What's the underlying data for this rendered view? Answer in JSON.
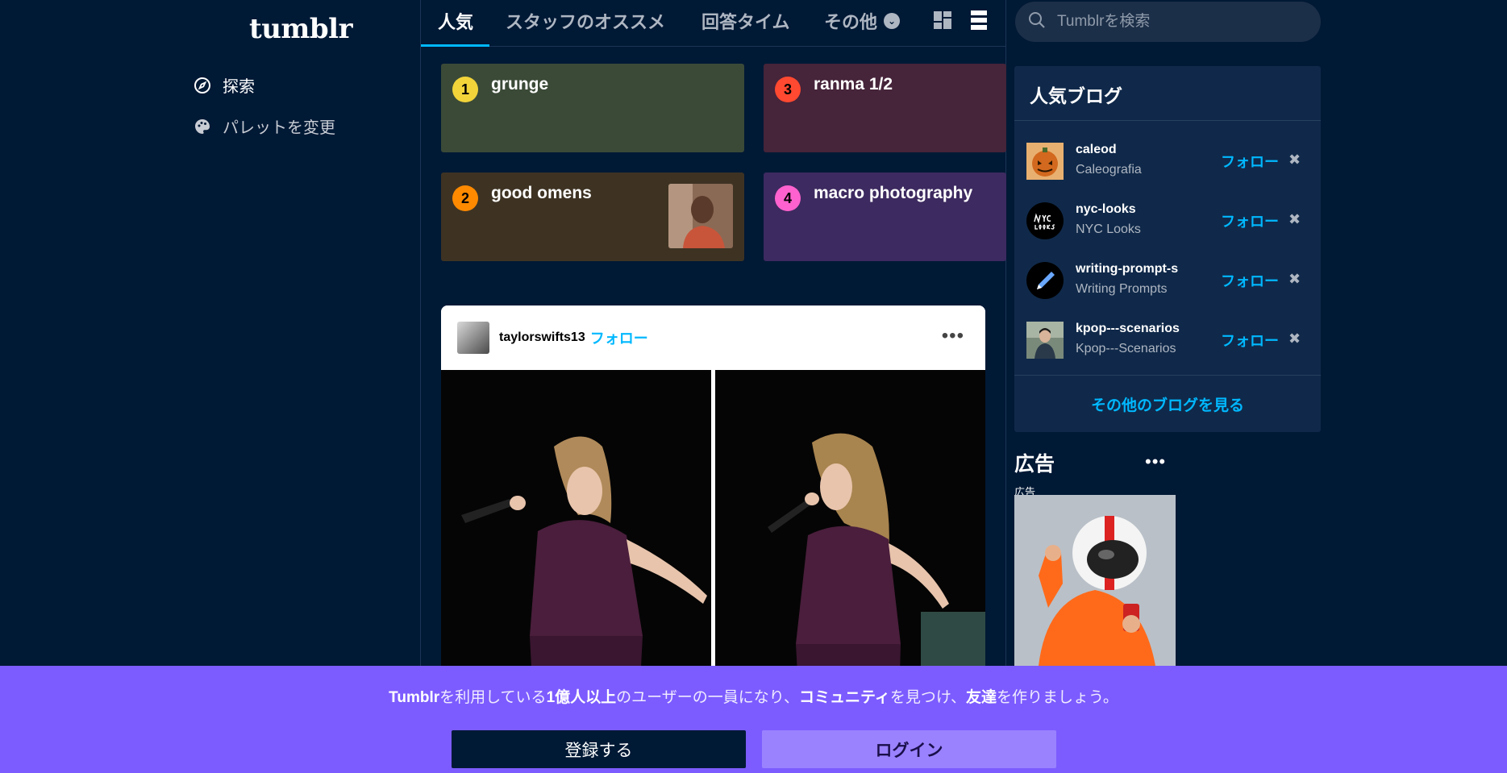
{
  "app": {
    "logo": "tumblr"
  },
  "nav": {
    "explore": {
      "label": "探索",
      "icon": "compass-icon"
    },
    "palette": {
      "label": "パレットを変更",
      "icon": "palette-icon"
    }
  },
  "tabs": [
    {
      "label": "人気"
    },
    {
      "label": "スタッフのオススメ"
    },
    {
      "label": "回答タイム"
    },
    {
      "label": "その他"
    }
  ],
  "trending": [
    {
      "rank": "1",
      "name": "grunge",
      "color": "#3b4a37",
      "badge": "#f2d43a"
    },
    {
      "rank": "3",
      "name": "ranma 1/2",
      "color": "#46243a",
      "badge": "#ff4930"
    },
    {
      "rank": "2",
      "name": "good omens",
      "color": "#3e3323",
      "badge": "#ff8a00"
    },
    {
      "rank": "4",
      "name": "macro photography",
      "color": "#3d2a60",
      "badge": "#ff62ce"
    }
  ],
  "post": {
    "username": "taylorswifts13",
    "follow_label": "フォロー",
    "menu": "•••"
  },
  "search": {
    "placeholder": "Tumblrを検索"
  },
  "popular_blogs": {
    "title": "人気ブログ",
    "items": [
      {
        "name": "caleod",
        "subtitle": "Caleografia",
        "follow": "フォロー"
      },
      {
        "name": "nyc-looks",
        "subtitle": "NYC Looks",
        "follow": "フォロー"
      },
      {
        "name": "writing-prompt-s",
        "subtitle": "Writing Prompts",
        "follow": "フォロー"
      },
      {
        "name": "kpop---scenarios",
        "subtitle": "Kpop---Scenarios",
        "follow": "フォロー"
      }
    ],
    "more": "その他のブログを見る"
  },
  "ad": {
    "title": "広告",
    "label": "広告",
    "menu": "•••"
  },
  "banner": {
    "t1": "Tumblr",
    "t2": "を利用している",
    "t3": "1億人以上",
    "t4": "のユーザーの一員になり、",
    "t5": "コミュニティ",
    "t6": "を見つけ、",
    "t7": "友達",
    "t8": "を作りましょう。",
    "register": "登録する",
    "login": "ログイン"
  },
  "colors": {
    "bg": "#001935",
    "accent": "#00b8ff",
    "banner": "#7c5cff"
  }
}
